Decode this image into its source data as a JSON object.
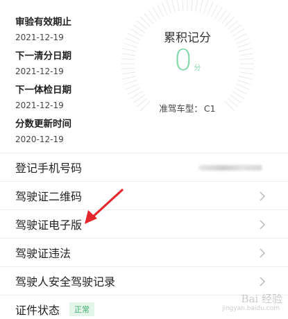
{
  "info": [
    {
      "label": "审验有效期止",
      "value": "2021-12-19"
    },
    {
      "label": "下一清分日期",
      "value": "2021-12-19"
    },
    {
      "label": "下一体检日期",
      "value": "2021-12-19"
    },
    {
      "label": "分数更新时间",
      "value": "2020-12-19"
    }
  ],
  "score": {
    "title": "累积记分",
    "value": "0",
    "unit": "分",
    "car_type_label": "准驾车型：",
    "car_type_value": "C1",
    "color": "#7fd7a8"
  },
  "list": [
    {
      "label": "登记手机号码"
    },
    {
      "label": "驾驶证二维码"
    },
    {
      "label": "驾驶证电子版"
    },
    {
      "label": "驾驶证违法"
    },
    {
      "label": "驾驶人安全驾驶记录"
    },
    {
      "label": "证件状态",
      "badge": "正常"
    }
  ],
  "watermark": {
    "line1": "Bai 经验",
    "line2": "jingyan.baidu.com"
  },
  "colors": {
    "arrow": "#e5262c",
    "badge_bg": "#e4f6ea",
    "badge_text": "#3fae6e"
  }
}
